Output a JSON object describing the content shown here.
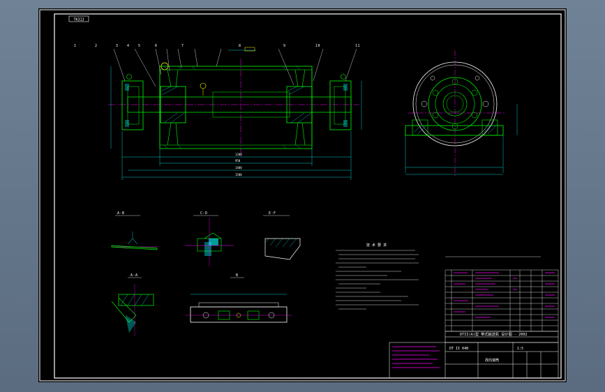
{
  "sheet": {
    "code_box": "TK313",
    "section_labels": [
      "A-B",
      "C-D",
      "E-F",
      "A-A",
      "B"
    ],
    "part_balloons": [
      "1",
      "2",
      "3",
      "4",
      "5",
      "6",
      "7",
      "8",
      "9",
      "10",
      "11"
    ],
    "notes_title": "技 术 要 求",
    "title_block": {
      "main_title": "DTII(A)型 带式输送机 设计图 - 2002",
      "drawing_name": "改向滚筒",
      "drawing_no": "DT II 04B",
      "scale": "1:5"
    }
  },
  "colors": {
    "frame": "#ffffff",
    "part": "#00ff00",
    "center": "#ff00ff",
    "dimension": "#00ffff",
    "text": "#ffffff",
    "table": "#ffffff",
    "highlight": "#ffff00"
  }
}
